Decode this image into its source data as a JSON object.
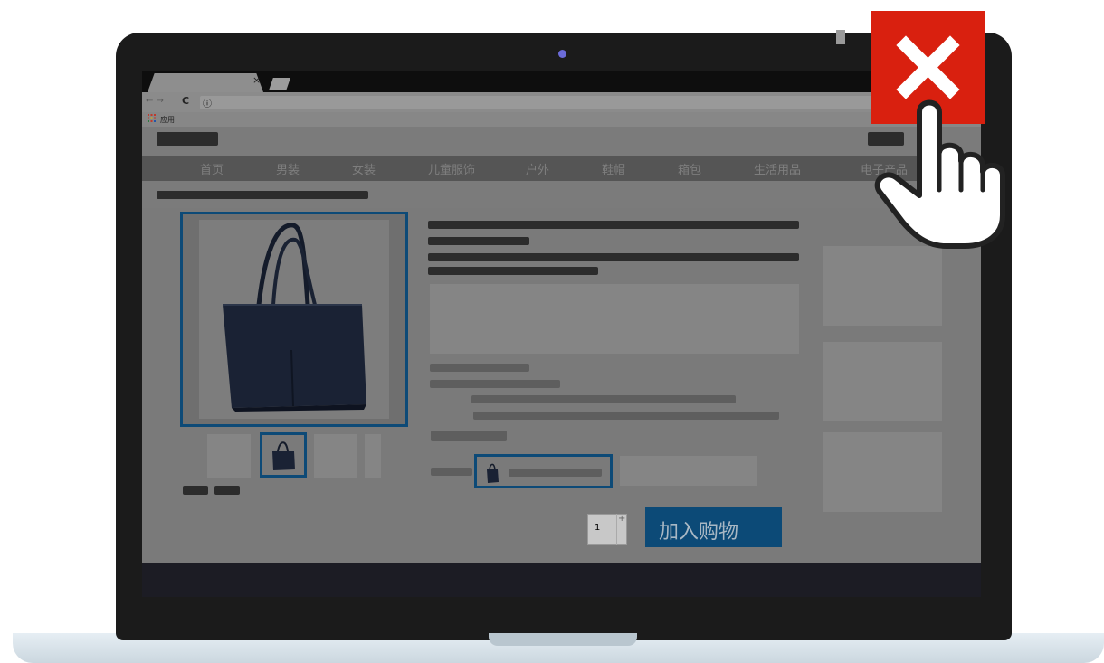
{
  "browser": {
    "tab_close_glyph": "×",
    "nav_arrows": "← →",
    "reload_icon": "C",
    "info_icon": "ⓘ",
    "apps_icon": "apps-grid-icon",
    "apps_label": "应用"
  },
  "nav": {
    "items": [
      "首页",
      "男装",
      "女装",
      "儿童服饰",
      "户外",
      "鞋帽",
      "箱包",
      "生活用品",
      "电子产品"
    ]
  },
  "product": {
    "quantity": "1",
    "qty_plus": "+",
    "add_to_cart_label": "加入购物"
  },
  "overlay": {
    "close_color": "#d9200f",
    "accent_color": "#0d4a77"
  }
}
